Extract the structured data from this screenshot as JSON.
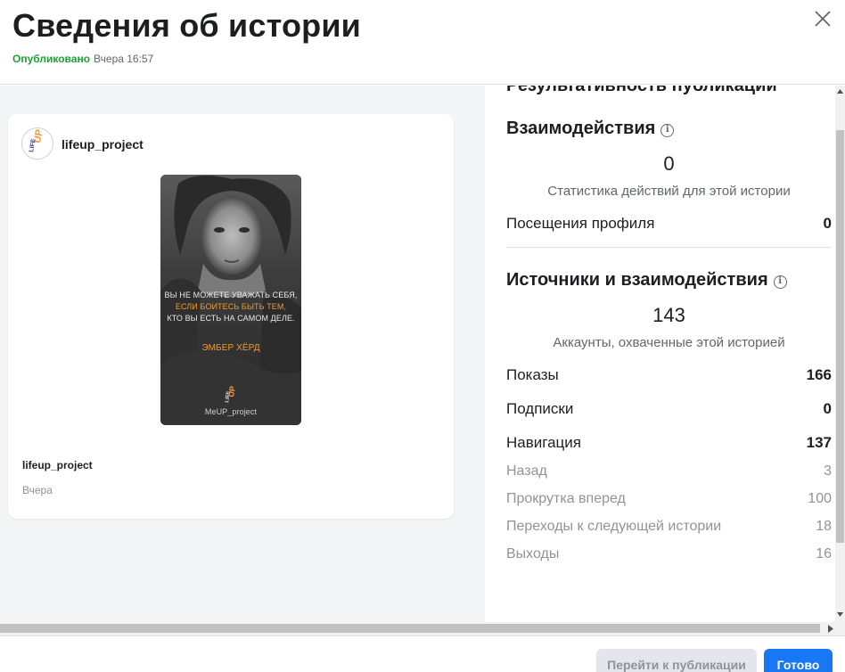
{
  "header": {
    "title": "Сведения об истории",
    "status": "Опубликовано",
    "time": "Вчера 16:57"
  },
  "post": {
    "account": "lifeup_project",
    "story": {
      "quote_line1": "ВЫ НЕ МОЖЕТЕ УВАЖАТЬ СЕБЯ,",
      "quote_line2": "ЕСЛИ БОИТЕСЬ БЫТЬ ТЕМ,",
      "quote_line3": "КТО ВЫ ЕСТЬ НА САМОМ ДЕЛЕ.",
      "author": "ЭМБЕР ХЁРД",
      "handle": "MeUP_project",
      "accent_color": "#f29a2e"
    },
    "caption_account": "lifeup_project",
    "caption_date": "Вчера"
  },
  "stats": {
    "clipped_title": "Результативность публикации",
    "interactions": {
      "title": "Взаимодействия",
      "value": "0",
      "description": "Статистика действий для этой истории",
      "rows": [
        {
          "label": "Посещения профиля",
          "value": "0"
        }
      ]
    },
    "discovery": {
      "title": "Источники и взаимодействия",
      "value": "143",
      "description": "Аккаунты, охваченные этой историей",
      "rows": [
        {
          "label": "Показы",
          "value": "166"
        },
        {
          "label": "Подписки",
          "value": "0"
        },
        {
          "label": "Навигация",
          "value": "137"
        }
      ],
      "sub_rows": [
        {
          "label": "Назад",
          "value": "3"
        },
        {
          "label": "Прокрутка вперед",
          "value": "100"
        },
        {
          "label": "Переходы к следующей истории",
          "value": "18"
        },
        {
          "label": "Выходы",
          "value": "16"
        }
      ]
    }
  },
  "footer": {
    "go_to_post": "Перейти к публикации",
    "done": "Готово"
  },
  "colors": {
    "published": "#1ea036",
    "primary": "#1877f2",
    "brand_orange": "#f29a2e"
  },
  "icons": [
    "close-icon",
    "info-icon",
    "avatar-logo"
  ]
}
